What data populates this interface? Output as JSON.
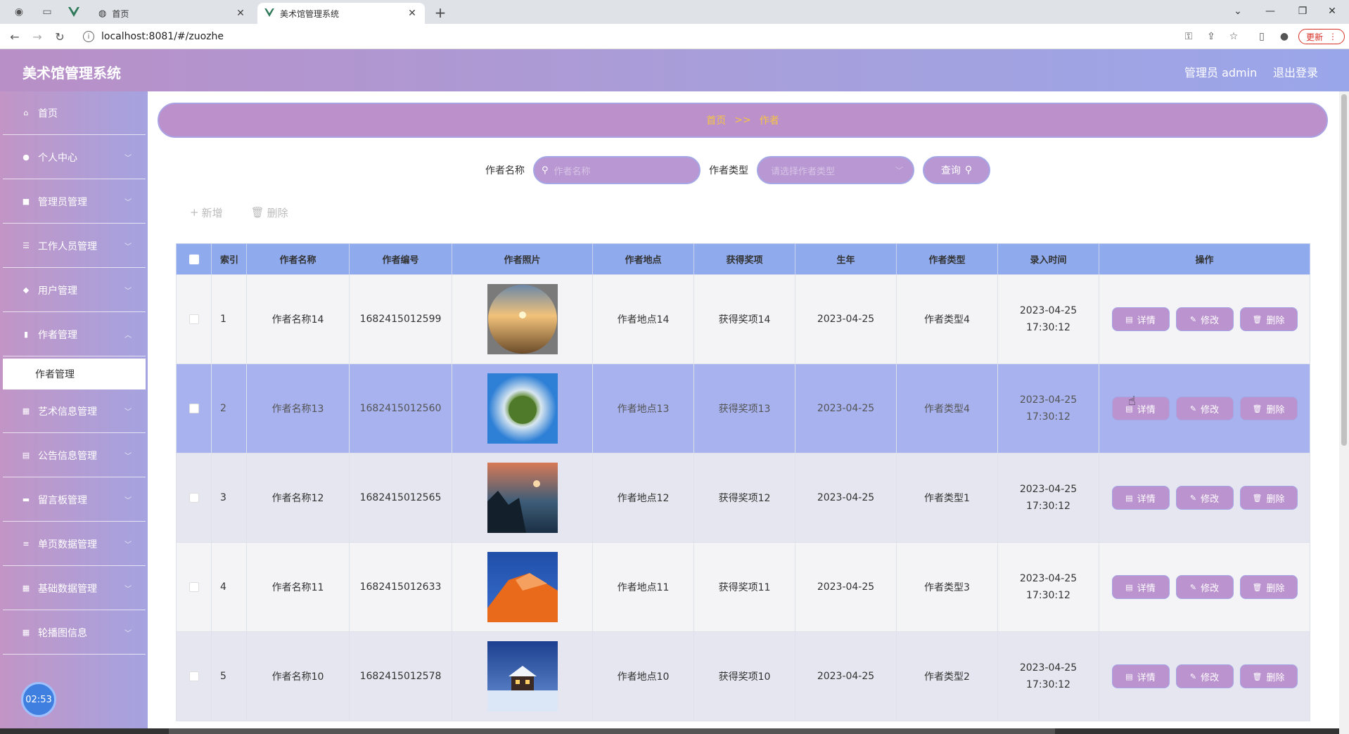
{
  "browser": {
    "tabs": [
      {
        "title": "首页",
        "active": false
      },
      {
        "title": "美术馆管理系统",
        "active": true
      }
    ],
    "url": "localhost:8081/#/zuozhe",
    "update_label": "更新"
  },
  "header": {
    "app_title": "美术馆管理系统",
    "admin_label": "管理员 admin",
    "logout_label": "退出登录"
  },
  "sidebar": {
    "items": [
      {
        "label": "首页",
        "icon": "home-icon"
      },
      {
        "label": "个人中心",
        "icon": "user-icon"
      },
      {
        "label": "管理员管理",
        "icon": "admin-icon"
      },
      {
        "label": "工作人员管理",
        "icon": "list-icon"
      },
      {
        "label": "用户管理",
        "icon": "users-icon"
      },
      {
        "label": "作者管理",
        "icon": "chart-icon"
      },
      {
        "label": "艺术信息管理",
        "icon": "grid-icon"
      },
      {
        "label": "公告信息管理",
        "icon": "clipboard-icon"
      },
      {
        "label": "留言板管理",
        "icon": "message-icon"
      },
      {
        "label": "单页数据管理",
        "icon": "sliders-icon"
      },
      {
        "label": "基础数据管理",
        "icon": "grid-icon"
      },
      {
        "label": "轮播图信息",
        "icon": "grid-icon"
      }
    ],
    "active_sub": "作者管理",
    "clock": "02:53"
  },
  "breadcrumb": {
    "home": "首页",
    "sep": ">>",
    "current": "作者"
  },
  "search": {
    "name_label": "作者名称",
    "name_placeholder": "作者名称",
    "type_label": "作者类型",
    "type_placeholder": "请选择作者类型",
    "query_label": "查询"
  },
  "actions": {
    "add_label": "新增",
    "delete_label": "删除"
  },
  "table": {
    "headers": [
      "索引",
      "作者名称",
      "作者编号",
      "作者照片",
      "作者地点",
      "获得奖项",
      "生年",
      "作者类型",
      "录入时间",
      "操作"
    ],
    "op_labels": {
      "detail": "详情",
      "edit": "修改",
      "delete": "删除"
    },
    "rows": [
      {
        "index": "1",
        "name": "作者名称14",
        "code": "1682415012599",
        "photo": "desert-sunset",
        "place": "作者地点14",
        "award": "获得奖项14",
        "birth": "2023-04-25",
        "type": "作者类型4",
        "time": "2023-04-25 17:30:12"
      },
      {
        "index": "2",
        "name": "作者名称13",
        "code": "1682415012560",
        "photo": "tiny-planet",
        "place": "作者地点13",
        "award": "获得奖项13",
        "birth": "2023-04-25",
        "type": "作者类型4",
        "time": "2023-04-25 17:30:12"
      },
      {
        "index": "3",
        "name": "作者名称12",
        "code": "1682415012565",
        "photo": "lake-moon",
        "place": "作者地点12",
        "award": "获得奖项12",
        "birth": "2023-04-25",
        "type": "作者类型1",
        "time": "2023-04-25 17:30:12"
      },
      {
        "index": "4",
        "name": "作者名称11",
        "code": "1682415012633",
        "photo": "orange-cliff",
        "place": "作者地点11",
        "award": "获得奖项11",
        "birth": "2023-04-25",
        "type": "作者类型3",
        "time": "2023-04-25 17:30:12"
      },
      {
        "index": "5",
        "name": "作者名称10",
        "code": "1682415012578",
        "photo": "snow-cabin",
        "place": "作者地点10",
        "award": "获得奖项10",
        "birth": "2023-04-25",
        "type": "作者类型2",
        "time": "2023-04-25 17:30:12"
      }
    ]
  },
  "colors": {
    "header_gradient_start": "#b98fc7",
    "header_gradient_end": "#9aa6ea",
    "table_header": "#8faaed",
    "breadcrumb_text": "#f5c543",
    "button_bg": "#bb93ce"
  }
}
